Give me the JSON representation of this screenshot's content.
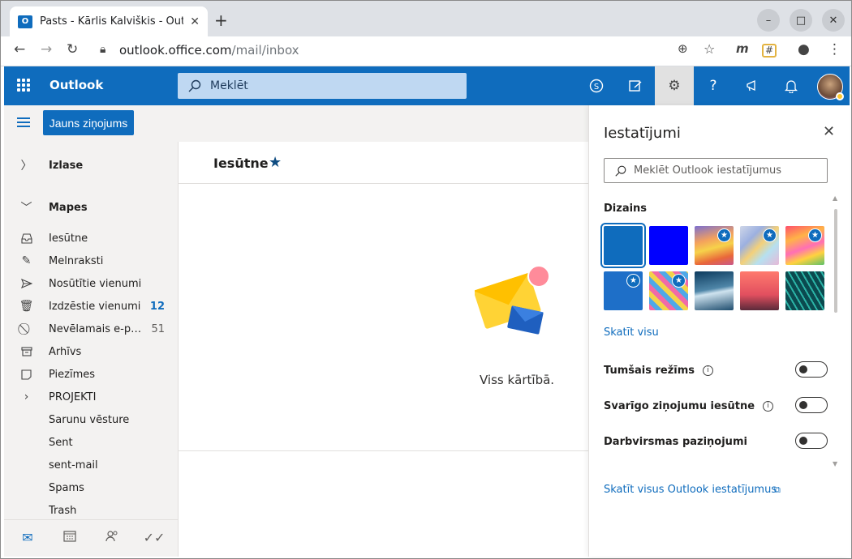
{
  "browser": {
    "tab_title": "Pasts - Kārlis Kalviškis - Outlook",
    "tab_close": "✕",
    "new_tab": "+",
    "url_host": "outlook.office.com",
    "url_path": "/mail/inbox",
    "win_min": "–",
    "win_max": "□",
    "win_close": "✕"
  },
  "header": {
    "brand": "Outlook",
    "search_placeholder": "Meklēt"
  },
  "command": {
    "new_message": "Jauns ziņojums"
  },
  "nav": {
    "favorites": "Izlase",
    "folders": "Mapes",
    "items": [
      {
        "label": "Iesūtne",
        "count": ""
      },
      {
        "label": "Melnraksti",
        "count": ""
      },
      {
        "label": "Nosūtītie vienumi",
        "count": ""
      },
      {
        "label": "Izdzēstie vienumi",
        "count": "12"
      },
      {
        "label": "Nevēlamais e-pasts",
        "count": "51"
      },
      {
        "label": "Arhīvs",
        "count": ""
      },
      {
        "label": "Piezīmes",
        "count": ""
      },
      {
        "label": "PROJEKTI",
        "count": ""
      },
      {
        "label": "Sarunu vēsture",
        "count": ""
      },
      {
        "label": "Sent",
        "count": ""
      },
      {
        "label": "sent-mail",
        "count": ""
      },
      {
        "label": "Spams",
        "count": ""
      },
      {
        "label": "Trash",
        "count": ""
      }
    ]
  },
  "list": {
    "title": "Iesūtne",
    "empty_text": "Viss kārtībā."
  },
  "settings": {
    "title": "Iestatījumi",
    "search_placeholder": "Meklēt Outlook iestatījumus",
    "theme_section": "Dizains",
    "see_all": "Skatīt visu",
    "toggles": [
      {
        "label": "Tumšais režīms",
        "info": true,
        "on": false
      },
      {
        "label": "Svarīgo ziņojumu iesūtne",
        "info": true,
        "on": false
      },
      {
        "label": "Darbvirsmas paziņojumi",
        "info": false,
        "on": false
      }
    ],
    "all_settings_link": "Skatīt visus Outlook iestatījumus"
  },
  "colors": {
    "accent": "#0f6cbd",
    "header_bg": "#0f6cbd",
    "theme_blue": "#0f6cbd",
    "theme_bright_blue": "#0000ff"
  }
}
